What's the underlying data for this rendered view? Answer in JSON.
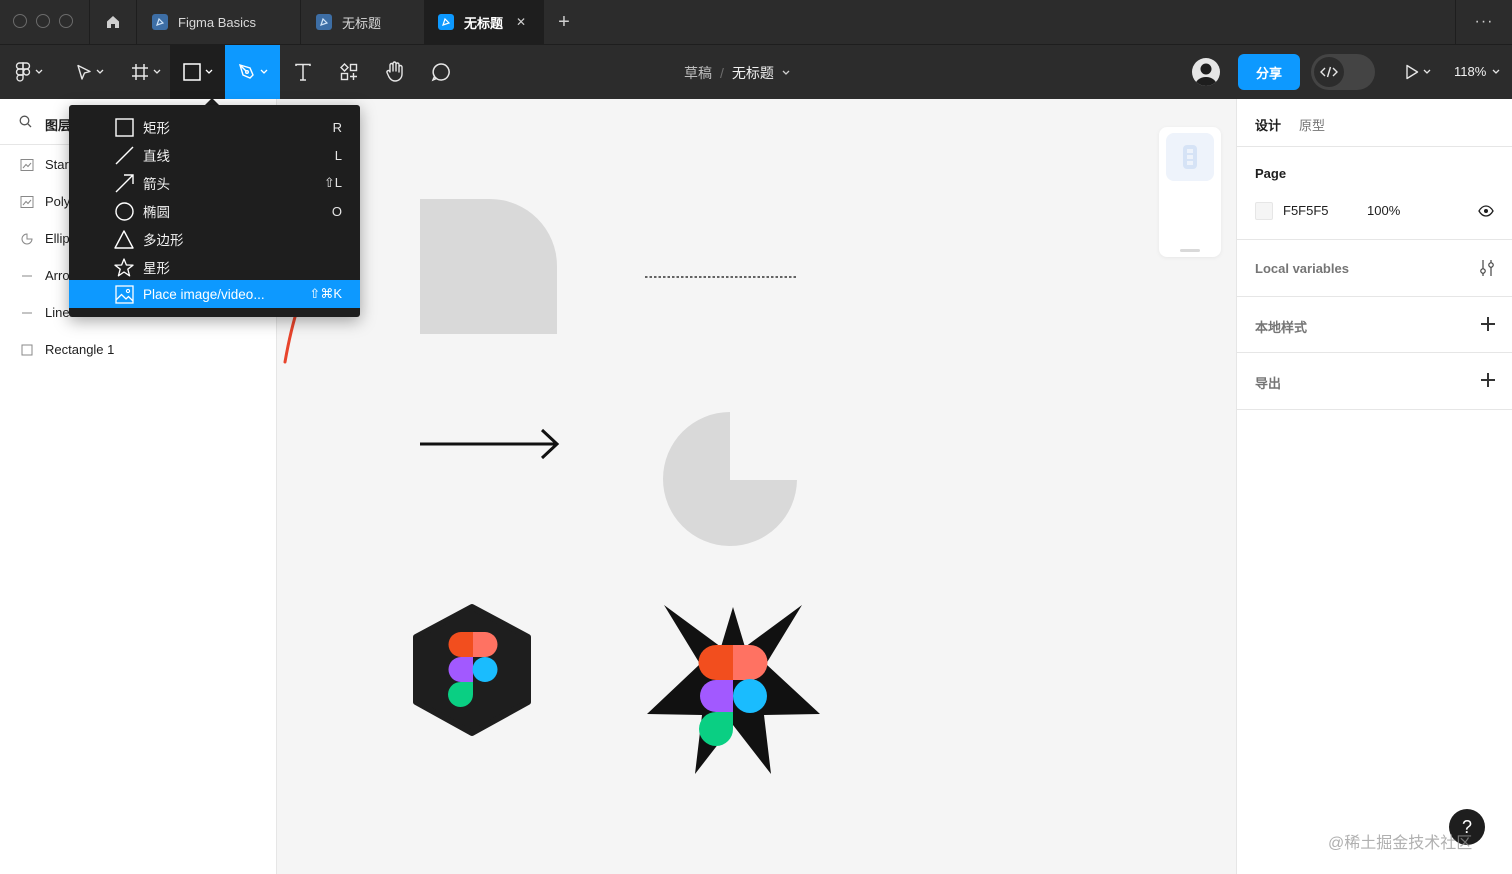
{
  "tabs": [
    {
      "label": "Figma Basics",
      "active": false
    },
    {
      "label": "无标题",
      "active": false
    },
    {
      "label": "无标题",
      "active": true
    }
  ],
  "tab_close_glyph": "✕",
  "tab_add_glyph": "+",
  "tab_more_glyph": "···",
  "breadcrumb": {
    "project": "草稿",
    "separator": "/",
    "file": "无标题"
  },
  "toolbar": {
    "share_label": "分享",
    "zoom_label": "118%",
    "tools": [
      "main-menu-icon",
      "move-icon",
      "frame-icon",
      "rectangle-icon",
      "pen-icon",
      "text-icon",
      "resources-icon",
      "hand-icon",
      "comment-icon"
    ]
  },
  "left_panel": {
    "search_label": "图层",
    "layers": [
      {
        "name": "Star",
        "icon": "star-layer-icon"
      },
      {
        "name": "Poly",
        "icon": "polygon-layer-icon"
      },
      {
        "name": "Ellip",
        "icon": "ellipse-layer-icon"
      },
      {
        "name": "Arro",
        "icon": "arrow-layer-icon"
      },
      {
        "name": "Line",
        "icon": "line-layer-icon"
      },
      {
        "name": "Rectangle 1",
        "icon": "rectangle-layer-icon"
      }
    ]
  },
  "shape_menu": {
    "items": [
      {
        "label": "矩形",
        "shortcut": "R",
        "icon": "rectangle-icon"
      },
      {
        "label": "直线",
        "shortcut": "L",
        "icon": "line-icon"
      },
      {
        "label": "箭头",
        "shortcut": "⇧L",
        "icon": "arrow-icon"
      },
      {
        "label": "椭圆",
        "shortcut": "O",
        "icon": "ellipse-icon"
      },
      {
        "label": "多边形",
        "shortcut": "",
        "icon": "polygon-icon"
      },
      {
        "label": "星形",
        "shortcut": "",
        "icon": "star-icon"
      },
      {
        "label": "Place image/video...",
        "shortcut": "⇧⌘K",
        "icon": "image-icon",
        "highlighted": true
      }
    ]
  },
  "right_panel": {
    "tabs": [
      "设计",
      "原型"
    ],
    "page_title": "Page",
    "page_color": "F5F5F5",
    "page_opacity": "100%",
    "local_variables": "Local variables",
    "local_styles": "本地样式",
    "export": "导出"
  },
  "help_label": "?",
  "watermark": "@稀土掘金技术社区",
  "colors": {
    "accent": "#0d99ff",
    "chrome": "#2c2c2c",
    "canvas": "#f5f5f5",
    "shape_fill": "#d9d9d9",
    "annotation_arrow": "#e8442c"
  }
}
